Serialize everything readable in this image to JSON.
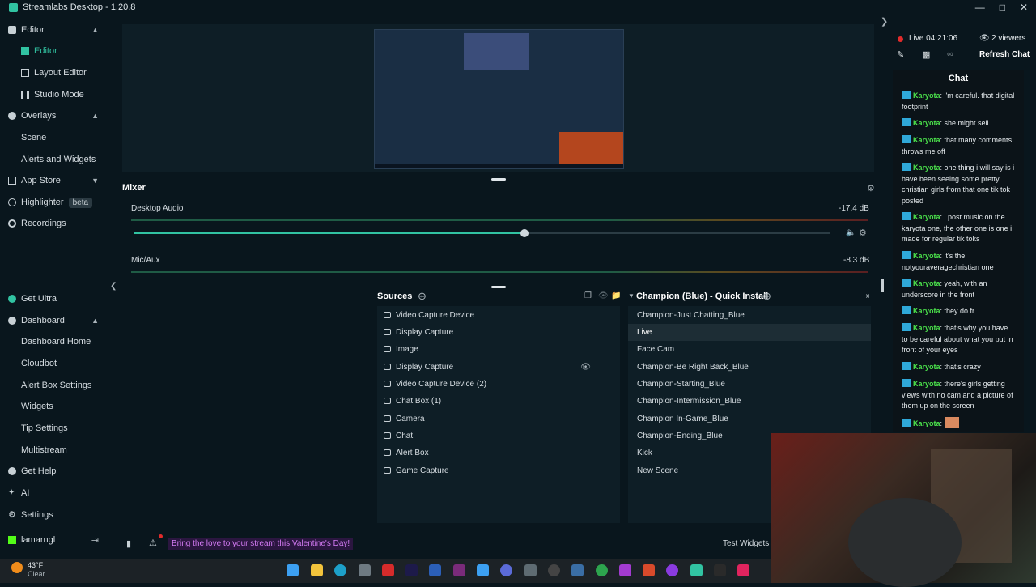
{
  "app": {
    "title": "Streamlabs Desktop - 1.20.8"
  },
  "sidebar": {
    "editor": {
      "label": "Editor",
      "children": [
        "Editor",
        "Layout Editor",
        "Studio Mode"
      ]
    },
    "overlays": {
      "label": "Overlays",
      "children": [
        "Scene",
        "Alerts and Widgets"
      ]
    },
    "app_store": "App Store",
    "highlighter": "Highlighter",
    "beta": "beta",
    "recordings": "Recordings",
    "get_ultra": "Get Ultra",
    "dashboard": {
      "label": "Dashboard",
      "children": [
        "Dashboard Home",
        "Cloudbot",
        "Alert Box Settings",
        "Widgets",
        "Tip Settings",
        "Multistream"
      ]
    },
    "get_help": "Get Help",
    "ai": "AI",
    "settings": "Settings",
    "user": "lamarngl"
  },
  "mixer": {
    "title": "Mixer",
    "channels": [
      {
        "name": "Desktop Audio",
        "db": "-17.4 dB",
        "volume_fraction": 0.56
      },
      {
        "name": "Mic/Aux",
        "db": "-8.3 dB"
      }
    ]
  },
  "sources": {
    "title": "Sources",
    "items": [
      "Video Capture Device",
      "Display Capture",
      "Image",
      "Display Capture",
      "Video Capture Device (2)",
      "Chat Box (1)",
      "Camera",
      "Chat",
      "Alert Box",
      "Game Capture"
    ]
  },
  "scenes": {
    "title": "Champion (Blue) - Quick Install",
    "items": [
      "Champion-Just Chatting_Blue",
      "Live",
      "Face Cam",
      "Champion-Be Right Back_Blue",
      "Champion-Starting_Blue",
      "Champion-Intermission_Blue",
      "Champion In-Game_Blue",
      "Champion-Ending_Blue",
      "Kick",
      "New Scene"
    ],
    "selected_index": 1
  },
  "footer": {
    "promo": "Bring the love to your stream this Valentine's Day!",
    "test_widgets": "Test Widgets"
  },
  "live": {
    "status": "Live 04:21:06",
    "viewers": "2 viewers",
    "refresh_chat": "Refresh Chat",
    "chat_title": "Chat"
  },
  "chat": {
    "messages": [
      {
        "user": "Karyota",
        "text": "i'm careful. that digital footprint"
      },
      {
        "user": "Karyota",
        "text": "she might sell"
      },
      {
        "user": "Karyota",
        "text": "that many comments throws me off"
      },
      {
        "user": "Karyota",
        "text": "one thing i will say is i have been seeing some pretty christian girls from that one tik tok i posted"
      },
      {
        "user": "Karyota",
        "text": "i post music on the karyota one, the other one is one i made for regular tik toks"
      },
      {
        "user": "Karyota",
        "text": "it's the notyouraveragechristian one"
      },
      {
        "user": "Karyota",
        "text": "yeah, with an underscore in the front"
      },
      {
        "user": "Karyota",
        "text": "they do fr"
      },
      {
        "user": "Karyota",
        "text": "that's why you have to be careful about what you put in front of your eyes"
      },
      {
        "user": "Karyota",
        "text": "that's crazy"
      },
      {
        "user": "Karyota",
        "text": "there's girls getting views with no cam and a picture of them up on the screen"
      },
      {
        "user": "Karyota",
        "text": ""
      }
    ]
  },
  "weather": {
    "temp": "43°F",
    "condition": "Clear"
  },
  "colors": {
    "accent": "#31c3a2",
    "live": "#e22b2b",
    "chat_user": "#4be24b",
    "promo": "#d57cf5"
  }
}
